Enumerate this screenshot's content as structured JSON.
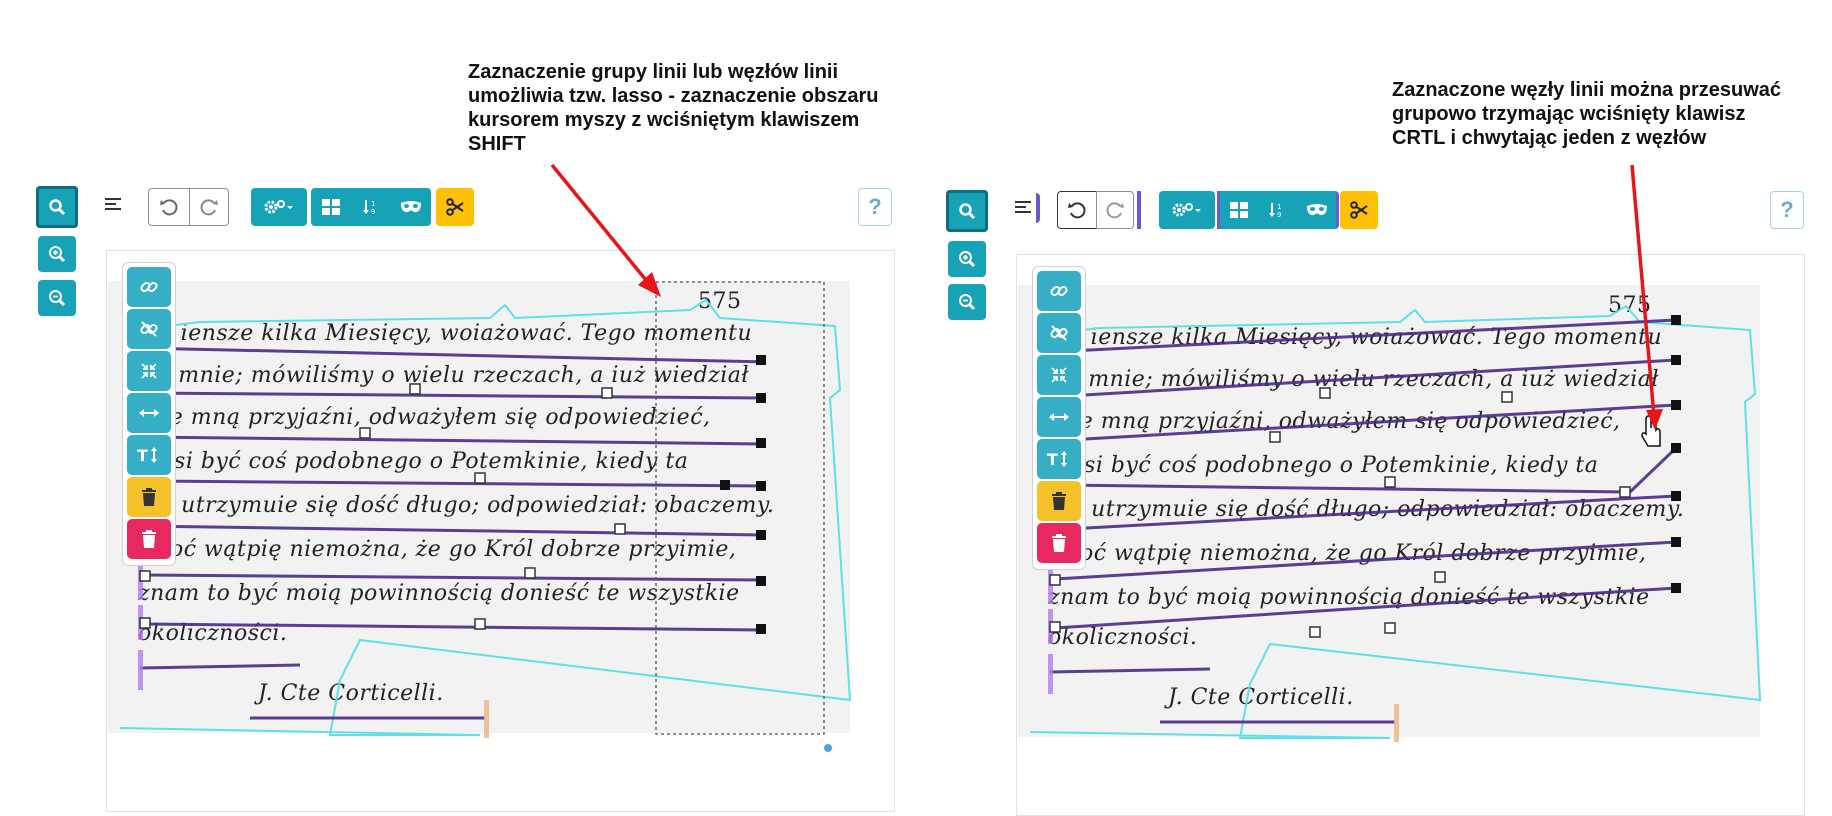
{
  "left_panel": {
    "annotation": [
      "Zaznaczenie grupy linii lub węzłów linii",
      "umożliwia tzw. lasso - zaznaczenie obszaru",
      "kursorem myszy z wciśniętym klawiszem",
      "SHIFT"
    ],
    "page_number": "575"
  },
  "right_panel": {
    "annotation": [
      "Zaznaczone węzły linii można przesuwać",
      "grupowo trzymając wciśnięty klawisz",
      "CRTL i chwytając jeden z węzłów"
    ],
    "page_number": "575"
  },
  "toolbar": {
    "help_label": "?",
    "icons": [
      "search-icon",
      "zoom-in-icon",
      "zoom-out-icon",
      "align-left-icon",
      "undo-icon",
      "redo-icon",
      "settings-icon",
      "layout-icon",
      "sort-icon",
      "mask-icon",
      "scissors-icon"
    ]
  },
  "line_tools": {
    "icons": [
      "link-icon",
      "unlink-icon",
      "compress-icon",
      "arrows-horizontal-icon",
      "text-height-icon",
      "trash-icon",
      "trash-all-icon"
    ]
  },
  "handwriting": [
    "niat iensze kilka Miesięcy, woiażować. Tego momentu",
    "ył u mnie; mówiliśmy o wielu rzeczach, a iuż wiedział",
    "ui ze mną przyjaźni, odważyłem się odpowiedzieć,",
    "musi być coś podobnego o Potemkinie, kiedy ta",
    "ieść utrzymuie się dość długo; odpowiedział: obaczemy.",
    "Choć wątpię niemożna, że go Król dobrze przyimie,",
    "znam to być moią powinnością donieść te wszystkie",
    "okoliczności.",
    "J. Cte Corticelli."
  ],
  "colors": {
    "teal": "#17a2b8",
    "yellow": "#ffc107",
    "pink": "#e8295f",
    "baseline": "#4b2b8a",
    "region": "#5ee0e8",
    "arrow": "#e8141a"
  }
}
